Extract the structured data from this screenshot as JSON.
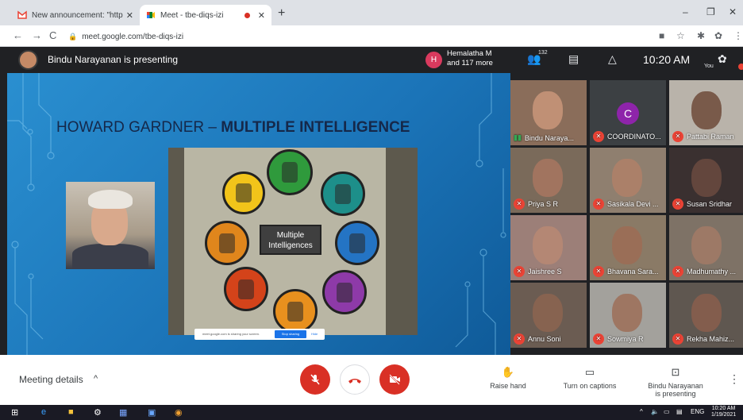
{
  "browser": {
    "tabs": [
      {
        "title": "New announcement: \"http://mee",
        "close": "✕"
      },
      {
        "title": "Meet - tbe-diqs-izi",
        "close": "✕"
      }
    ],
    "new_tab": "+",
    "window_controls": {
      "minimize": "–",
      "restore": "❐",
      "close": "✕"
    },
    "nav": {
      "back": "←",
      "forward": "→",
      "reload": "C"
    },
    "url": "meet.google.com/tbe-diqs-izi"
  },
  "meet": {
    "presenter_text": "Bindu Narayanan is presenting",
    "participants_badge": {
      "initial": "H",
      "line1": "Hemalatha M",
      "line2": "and 117 more"
    },
    "participant_count": "132",
    "time": "10:20 AM",
    "you_label": "You"
  },
  "slide": {
    "title_normal": "HOWARD GARDNER – ",
    "title_bold": "MULTIPLE INTELLIGENCE",
    "center_label_1": "Multiple",
    "center_label_2": "Intelligences",
    "share_text": "meet.google.com is sharing your screen.",
    "stop_sharing": "Stop sharing",
    "hide": "Hide"
  },
  "participants": [
    {
      "name": "Bindu Naraya...",
      "muted": false,
      "bg": "#8a6d5a",
      "skin": "#c9977a"
    },
    {
      "name": "COORDINATO...",
      "muted": true,
      "bg": "#3c4043",
      "avatar": "C"
    },
    {
      "name": "Pattabi Raman",
      "muted": true,
      "bg": "#b9b3aa",
      "skin": "#6d4a3a"
    },
    {
      "name": "Priya S R",
      "muted": true,
      "bg": "#7a6a5a",
      "skin": "#a87560"
    },
    {
      "name": "Sasikala Devi ...",
      "muted": true,
      "bg": "#8f7f6f",
      "skin": "#b08068"
    },
    {
      "name": "Susan Sridhar",
      "muted": true,
      "bg": "#3a3030",
      "skin": "#6b4a40"
    },
    {
      "name": "Jaishree S",
      "muted": true,
      "bg": "#9c7f78",
      "skin": "#b98873"
    },
    {
      "name": "Bhavana Sara...",
      "muted": true,
      "bg": "#8a7a66",
      "skin": "#9c6c55"
    },
    {
      "name": "Madhumathy ...",
      "muted": true,
      "bg": "#7e7266",
      "skin": "#a27a66"
    },
    {
      "name": "Annu Soni",
      "muted": true,
      "bg": "#6b5c52",
      "skin": "#8c6450"
    },
    {
      "name": "Sowmiya R",
      "muted": true,
      "bg": "#a3a19c",
      "skin": "#9d6f58"
    },
    {
      "name": "Rekha Mahiz...",
      "muted": true,
      "bg": "#5f5750",
      "skin": "#8a5e4c"
    }
  ],
  "controls": {
    "meeting_details": "Meeting details",
    "chevron": "^",
    "raise_hand": "Raise hand",
    "captions": "Turn on captions",
    "presenting_line1": "Bindu Narayanan",
    "presenting_line2": "is presenting",
    "more": "⋮"
  },
  "taskbar": {
    "lang": "ENG",
    "time": "10:20 AM",
    "date": "1/19/2021"
  },
  "colors": {
    "danger": "#d93025",
    "slide_blue": "#1b74b8",
    "meet_dark": "#202124"
  }
}
